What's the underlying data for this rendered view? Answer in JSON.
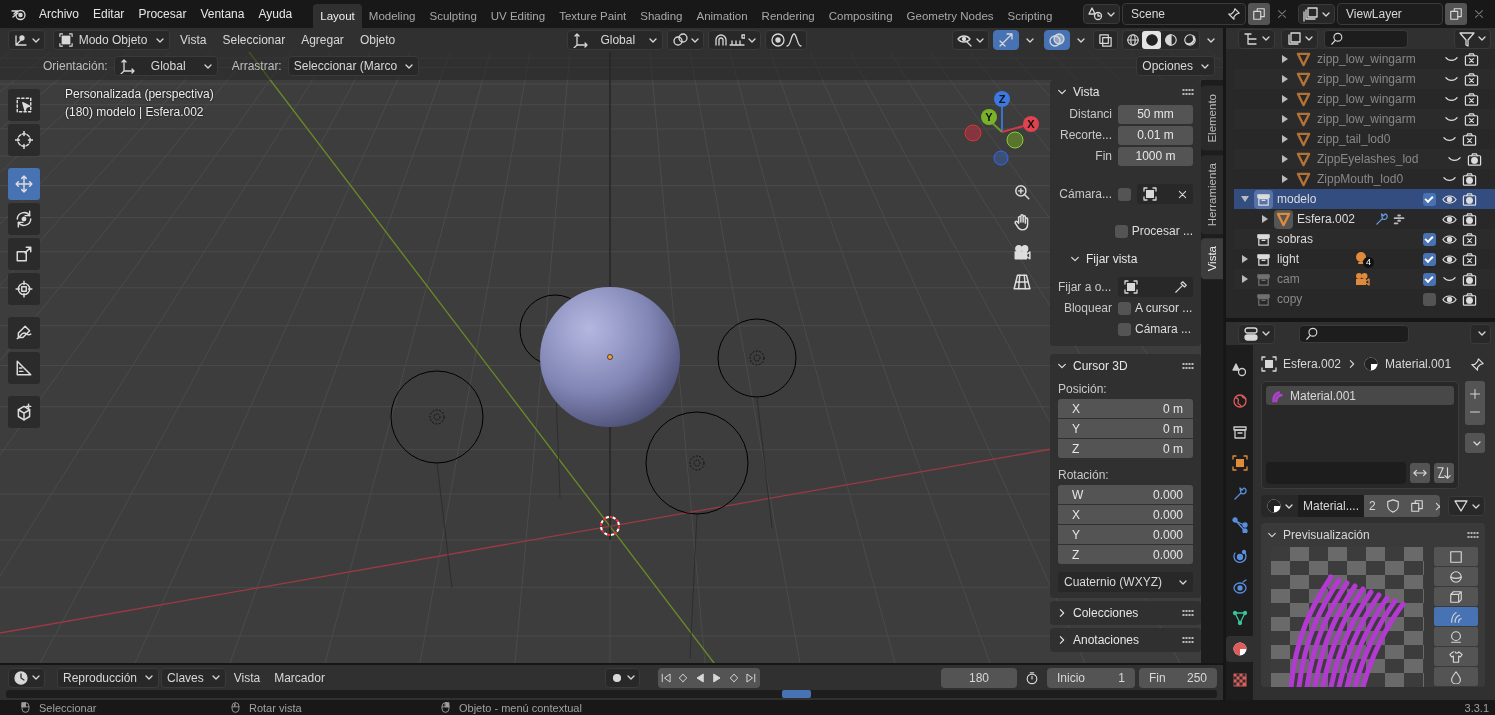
{
  "menu": [
    "Archivo",
    "Editar",
    "Procesar",
    "Ventana",
    "Ayuda"
  ],
  "workspaces": [
    {
      "label": "Layout",
      "selected": true
    },
    {
      "label": "Modeling",
      "selected": false
    },
    {
      "label": "Sculpting",
      "selected": false
    },
    {
      "label": "UV Editing",
      "selected": false
    },
    {
      "label": "Texture Paint",
      "selected": false
    },
    {
      "label": "Shading",
      "selected": false
    },
    {
      "label": "Animation",
      "selected": false
    },
    {
      "label": "Rendering",
      "selected": false
    },
    {
      "label": "Compositing",
      "selected": false
    },
    {
      "label": "Geometry Nodes",
      "selected": false
    },
    {
      "label": "Scripting",
      "selected": false
    }
  ],
  "scene": "Scene",
  "view_layer": "ViewLayer",
  "viewport_header": {
    "mode": "Modo Objeto",
    "menus": [
      "Vista",
      "Seleccionar",
      "Agregar",
      "Objeto"
    ],
    "transform_orientation": "Global",
    "shading": [
      {
        "kind": "wireframe",
        "selected": false
      },
      {
        "kind": "solid",
        "selected": true
      },
      {
        "kind": "material",
        "selected": false
      },
      {
        "kind": "rendered",
        "selected": false
      }
    ]
  },
  "tool_settings": {
    "orientation_label": "Orientación:",
    "orientation": "Global",
    "drag_label": "Arrastrar:",
    "drag": "Seleccionar (Marco",
    "options": "Opciones"
  },
  "overlay": {
    "view_name": "Personalizada (perspectiva)",
    "object_info": "(180) modelo | Esfera.002"
  },
  "gizmo_axes": [
    "Z",
    "Y",
    "X"
  ],
  "tools": [
    {
      "kind": "select-box",
      "selected": false
    },
    {
      "kind": "cursor",
      "selected": false
    },
    {
      "kind": "move",
      "selected": true
    },
    {
      "kind": "rotate",
      "selected": false
    },
    {
      "kind": "scale",
      "selected": false
    },
    {
      "kind": "transform",
      "selected": false
    },
    {
      "kind": "annotate",
      "selected": false
    },
    {
      "kind": "measure",
      "selected": false
    },
    {
      "kind": "add-cube",
      "selected": false
    }
  ],
  "sidebar_tabs": [
    {
      "label": "Elemento",
      "selected": false
    },
    {
      "label": "Herramienta",
      "selected": false
    },
    {
      "label": "Vista",
      "selected": true
    }
  ],
  "view_panel": {
    "title": "Vista",
    "expanded": true,
    "fields": [
      {
        "label": "Distanci",
        "value": "50 mm"
      },
      {
        "label": "Recorte...",
        "value": "0.01 m"
      },
      {
        "label": "Fin",
        "value": "1000 m"
      }
    ],
    "camera_label": "Cámara...",
    "lock_camera": false,
    "render_region": {
      "label": "Procesar ...",
      "checked": false
    },
    "lock_panel": {
      "title": "Fijar vista",
      "expanded": true,
      "object_label": "Fijar a o...",
      "lock_label": "Bloquear",
      "options": [
        {
          "label": "A cursor ...",
          "checked": false
        },
        {
          "label": "Cámara ...",
          "checked": false
        }
      ]
    }
  },
  "cursor_panel": {
    "title": "Cursor 3D",
    "expanded": true,
    "location_label": "Posición:",
    "location": [
      {
        "axis": "X",
        "value": "0 m"
      },
      {
        "axis": "Y",
        "value": "0 m"
      },
      {
        "axis": "Z",
        "value": "0 m"
      }
    ],
    "rotation_label": "Rotación:",
    "rotation": [
      {
        "axis": "W",
        "value": "0.000"
      },
      {
        "axis": "X",
        "value": "0.000"
      },
      {
        "axis": "Y",
        "value": "0.000"
      },
      {
        "axis": "Z",
        "value": "0.000"
      }
    ],
    "rotation_mode": "Cuaternio (WXYZ)"
  },
  "collapsed_panels": [
    {
      "title": "Colecciones",
      "expanded": false
    },
    {
      "title": "Anotaciones",
      "expanded": false
    }
  ],
  "outliner": {
    "nested_items": [
      {
        "name": "zipp_low_wingarm",
        "kind": "mesh",
        "expanded": false,
        "selected": false,
        "dimmed": true,
        "visible": false,
        "renderable": false
      },
      {
        "name": "zipp_low_wingarm",
        "kind": "mesh",
        "expanded": false,
        "selected": false,
        "dimmed": true,
        "visible": false,
        "renderable": false
      },
      {
        "name": "zipp_low_wingarm",
        "kind": "mesh",
        "expanded": false,
        "selected": false,
        "dimmed": true,
        "visible": false,
        "renderable": false
      },
      {
        "name": "zipp_low_wingarm",
        "kind": "mesh",
        "expanded": false,
        "selected": false,
        "dimmed": true,
        "visible": false,
        "renderable": false
      },
      {
        "name": "zipp_tail_lod0",
        "kind": "mesh",
        "expanded": false,
        "selected": false,
        "dimmed": true,
        "visible": false,
        "renderable": false
      },
      {
        "name": "ZippEyelashes_lod",
        "kind": "mesh",
        "expanded": false,
        "selected": false,
        "dimmed": true,
        "visible": false,
        "renderable": true
      },
      {
        "name": "ZippMouth_lod0",
        "kind": "mesh",
        "expanded": false,
        "selected": false,
        "dimmed": true,
        "visible": false,
        "renderable": true
      }
    ],
    "items": [
      {
        "name": "modelo",
        "kind": "collection",
        "expanded": true,
        "selected": true,
        "dimmed": false,
        "checked": true,
        "visible": true,
        "renderable": true,
        "children": [
          {
            "name": "Esfera.002",
            "kind": "mesh",
            "expanded": false,
            "selected": false,
            "dimmed": false,
            "visible": true,
            "renderable": true,
            "modifiers": true
          }
        ]
      },
      {
        "name": "sobras",
        "kind": "collection",
        "selected": false,
        "dimmed": false,
        "checked": true,
        "visible": true,
        "renderable": false
      },
      {
        "name": "light",
        "kind": "collection",
        "expanded": false,
        "selected": false,
        "dimmed": false,
        "checked": true,
        "visible": true,
        "renderable": false,
        "contents": {
          "kind": "light",
          "count": "4"
        }
      },
      {
        "name": "cam",
        "kind": "collection",
        "expanded": false,
        "selected": false,
        "dimmed": true,
        "checked": true,
        "visible": false,
        "renderable": true,
        "contents": {
          "kind": "camera"
        }
      },
      {
        "name": "copy",
        "kind": "collection",
        "selected": false,
        "dimmed": true,
        "checked": false,
        "visible": true,
        "renderable": true
      }
    ]
  },
  "properties": {
    "tabs": [
      {
        "kind": "scene",
        "selected": false
      },
      {
        "kind": "world",
        "selected": false
      },
      {
        "kind": "collection",
        "selected": false
      },
      {
        "kind": "object",
        "selected": false
      },
      {
        "kind": "modifiers",
        "selected": false
      },
      {
        "kind": "particles",
        "selected": false
      },
      {
        "kind": "physics",
        "selected": false
      },
      {
        "kind": "constraints",
        "selected": false
      },
      {
        "kind": "data",
        "selected": false
      },
      {
        "kind": "material",
        "selected": true
      },
      {
        "kind": "texture",
        "selected": false
      }
    ],
    "breadcrumb": [
      "Esfera.002",
      "Material.001"
    ],
    "slots": [
      {
        "name": "Material.001",
        "selected": true
      }
    ],
    "material_name": "Material....",
    "users": "2",
    "preview": {
      "title": "Previsualización",
      "expanded": true,
      "shapes": [
        {
          "kind": "flat",
          "selected": false
        },
        {
          "kind": "sphere",
          "selected": false
        },
        {
          "kind": "cube",
          "selected": false
        },
        {
          "kind": "hair",
          "selected": true
        },
        {
          "kind": "shader-ball",
          "selected": false
        },
        {
          "kind": "cloth",
          "selected": false
        },
        {
          "kind": "fluid",
          "selected": false
        }
      ]
    }
  },
  "timeline": {
    "menus": [
      {
        "label": "Reproducción",
        "kind": "dropdown"
      },
      {
        "label": "Claves",
        "kind": "dropdown"
      },
      {
        "label": "Vista",
        "kind": "menu"
      },
      {
        "label": "Marcador",
        "kind": "menu"
      }
    ],
    "current_frame": "180",
    "start_label": "Inicio",
    "start": "1",
    "end_label": "Fin",
    "end": "250"
  },
  "status_bar": {
    "hints": [
      {
        "kind": "left-click",
        "label": "Seleccionar"
      },
      {
        "kind": "middle-click",
        "label": "Rotar vista"
      },
      {
        "kind": "right-click",
        "label": "Objeto - menú contextual"
      }
    ],
    "version": "3.3.1"
  }
}
